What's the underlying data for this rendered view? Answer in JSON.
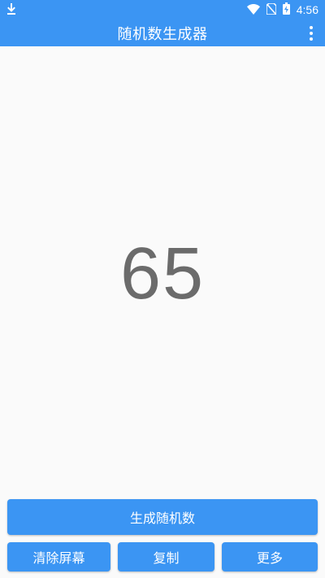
{
  "status_bar": {
    "time": "4:56",
    "icons": [
      "download-icon",
      "wifi-icon",
      "no-sim-icon",
      "battery-charging-icon"
    ]
  },
  "app_bar": {
    "title": "随机数生成器",
    "menu_icon": "more-vert-icon"
  },
  "display": {
    "number": "65"
  },
  "buttons": {
    "generate": "生成随机数",
    "clear": "清除屏幕",
    "copy": "复制",
    "more": "更多"
  },
  "colors": {
    "primary": "#3b95f3",
    "background": "#fafafa",
    "number_text": "#6b6b6b",
    "button_text": "#ffffff"
  }
}
